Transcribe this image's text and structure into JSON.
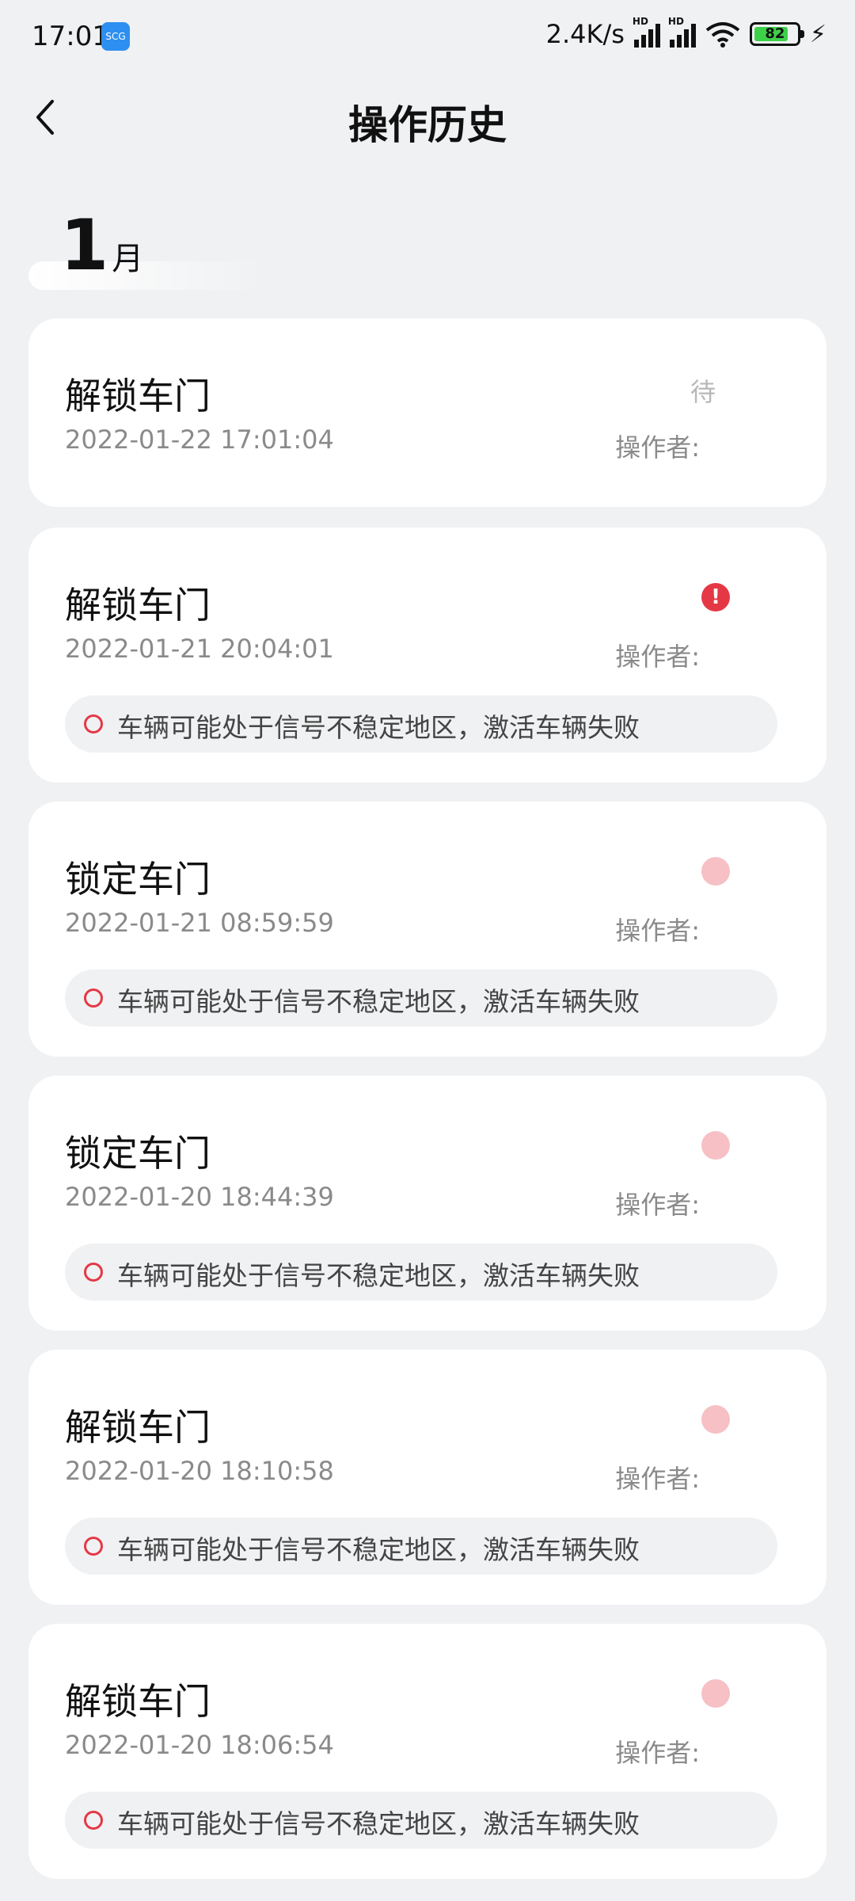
{
  "status_bar": {
    "time": "17:01",
    "app_badge": "SCG",
    "net_speed": "2.4K/s",
    "signal_label": "HD",
    "battery_level": "82"
  },
  "header": {
    "title": "操作历史"
  },
  "month": {
    "number": "1",
    "unit": "月"
  },
  "operator_label": "操作者:",
  "records": [
    {
      "action": "解锁车门",
      "time": "2022-01-22 17:01:04",
      "status": "待",
      "alert": false,
      "message": ""
    },
    {
      "action": "解锁车门",
      "time": "2022-01-21 20:04:01",
      "status": "",
      "alert": true,
      "message": "车辆可能处于信号不稳定地区，激活车辆失败"
    },
    {
      "action": "锁定车门",
      "time": "2022-01-21 08:59:59",
      "status": "",
      "alert": true,
      "message": "车辆可能处于信号不稳定地区，激活车辆失败"
    },
    {
      "action": "锁定车门",
      "time": "2022-01-20 18:44:39",
      "status": "",
      "alert": true,
      "message": "车辆可能处于信号不稳定地区，激活车辆失败"
    },
    {
      "action": "解锁车门",
      "time": "2022-01-20 18:10:58",
      "status": "",
      "alert": true,
      "message": "车辆可能处于信号不稳定地区，激活车辆失败"
    },
    {
      "action": "解锁车门",
      "time": "2022-01-20 18:06:54",
      "status": "",
      "alert": true,
      "message": "车辆可能处于信号不稳定地区，激活车辆失败"
    }
  ],
  "colors": {
    "background": "#f0f1f3",
    "card": "#ffffff",
    "alert": "#e53845",
    "secondary_text": "#8a8a8a"
  }
}
